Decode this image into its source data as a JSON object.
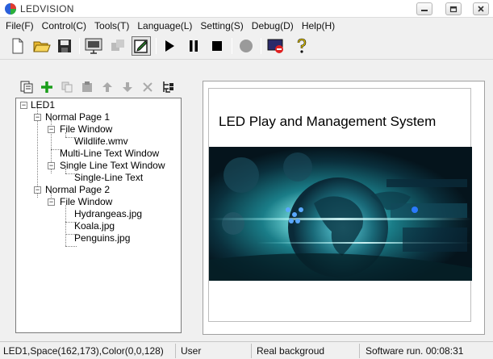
{
  "window": {
    "title": "LEDVISION"
  },
  "menu": [
    {
      "label": "File(F)"
    },
    {
      "label": "Control(C)"
    },
    {
      "label": "Tools(T)"
    },
    {
      "label": "Language(L)"
    },
    {
      "label": "Setting(S)"
    },
    {
      "label": "Debug(D)"
    },
    {
      "label": "Help(H)"
    }
  ],
  "toolbar_icons": [
    "new-file-icon",
    "open-folder-icon",
    "save-icon",
    "screen-display-icon",
    "disabled-tool-icon",
    "edit-program-icon",
    "play-icon",
    "pause-icon",
    "stop-icon",
    "record-icon",
    "screen-off-icon",
    "help-icon"
  ],
  "tree": {
    "nodes": [
      {
        "label": "LED1"
      },
      {
        "label": "Normal Page 1"
      },
      {
        "label": "File Window"
      },
      {
        "label": "Wildlife.wmv"
      },
      {
        "label": "Multi-Line Text Window"
      },
      {
        "label": "Single Line Text Window"
      },
      {
        "label": "Single-Line Text"
      },
      {
        "label": "Normal Page 2"
      },
      {
        "label": "File Window"
      },
      {
        "label": "Hydrangeas.jpg"
      },
      {
        "label": "Koala.jpg"
      },
      {
        "label": "Penguins.jpg"
      }
    ]
  },
  "preview": {
    "title": "LED Play and Management System"
  },
  "status": {
    "coords": "LED1,Space(162,173),Color(0,0,128)",
    "user": "User",
    "background": "Real backgroud",
    "runtime": "Software run. 00:08:31"
  },
  "colors": {
    "accent_green": "#1a9e1a",
    "dark_blue": "#0a2a4a",
    "tree_line": "#808080"
  }
}
